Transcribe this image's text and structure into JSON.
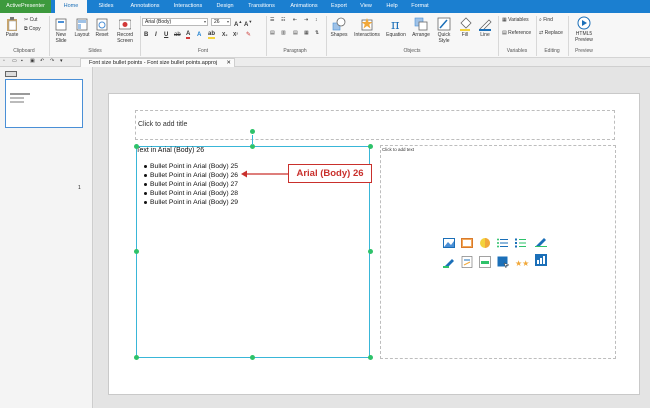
{
  "menu": {
    "app": "ActivePresenter",
    "tabs": [
      "Home",
      "Slides",
      "Annotations",
      "Interactions",
      "Design",
      "Transitions",
      "Animations",
      "Export",
      "View",
      "Help",
      "Format"
    ]
  },
  "ribbon": {
    "clipboard": {
      "paste": "Paste",
      "cut": "Cut",
      "copy": "Copy",
      "label": "Clipboard"
    },
    "slides": {
      "new_slide": "New Slide",
      "layout": "Layout",
      "reset": "Reset",
      "record_screen": "Record Screen",
      "label": "Slides"
    },
    "font": {
      "family": "Arial (Body)",
      "size": "26",
      "label": "Font"
    },
    "paragraph": {
      "label": "Paragraph"
    },
    "objects": {
      "shapes": "Shapes",
      "interactions": "Interactions",
      "equation": "Equation",
      "arrange": "Arrange",
      "quick_style": "Quick Style",
      "fill": "Fill",
      "line": "Line",
      "label": "Objects"
    },
    "variables": {
      "variables": "Variables",
      "reference": "Reference",
      "label": "Variables"
    },
    "editing": {
      "find": "Find",
      "replace": "Replace",
      "label": "Editing"
    },
    "preview": {
      "html5": "HTML5 Preview",
      "label": "Preview"
    }
  },
  "document_tab": "Font size bullet points - Font size bullet points.approj",
  "slide_thumb_number": "1",
  "slide": {
    "title_placeholder": "Click to add title",
    "body_heading": "Text in Arial (Body) 26",
    "bullets": [
      "Bullet Point in Arial (Body) 25",
      "Bullet Point in Arial (Body) 26",
      "Bullet Point in Arial (Body) 27",
      "Bullet Point in Arial (Body) 28",
      "Bullet Point in Arial (Body) 29"
    ],
    "right_placeholder": "Click to add text",
    "callout": "Arial (Body) 26"
  },
  "colors": {
    "menubar": "#1b7fd0",
    "app_button": "#3d9a3d",
    "selection": "#39b6d8",
    "handle": "#2ec26a",
    "callout": "#c9302c"
  }
}
